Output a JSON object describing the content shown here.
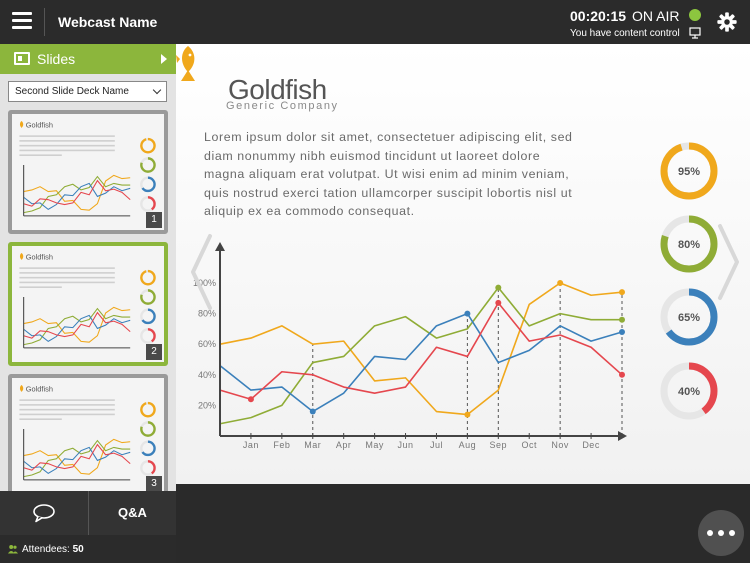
{
  "topbar": {
    "webcast_name": "Webcast Name",
    "timer": "00:20:15",
    "status": "ON AIR",
    "control_text": "You have content control",
    "status_color": "#8cc63f"
  },
  "sidebar": {
    "slides_label": "Slides",
    "deck_select": "Second Slide Deck Name",
    "thumbnails": [
      {
        "number": "1"
      },
      {
        "number": "2"
      },
      {
        "number": "3"
      }
    ],
    "qa_label": "Q&A",
    "attendees_label": "Attendees:",
    "attendees_count": "50",
    "accent_color": "#8cb63c"
  },
  "slide": {
    "brand_name": "Goldfish",
    "brand_sub": "Generic Company",
    "body_text": "Lorem ipsum dolor sit amet, consectetuer adipiscing elit, sed diam nonummy nibh euismod tincidunt ut laoreet dolore magna aliquam erat volutpat. Ut wisi enim ad minim veniam, quis nostrud exerci tation ullamcorper suscipit lobortis nisl ut aliquip ex ea commodo consequat.",
    "donuts": [
      {
        "label": "95%",
        "value": 95,
        "color": "#f0a81c"
      },
      {
        "label": "80%",
        "value": 80,
        "color": "#8fac36"
      },
      {
        "label": "65%",
        "value": 65,
        "color": "#3b80bb"
      },
      {
        "label": "40%",
        "value": 40,
        "color": "#e5474e"
      }
    ]
  },
  "chart_data": {
    "type": "line",
    "categories": [
      "Jan",
      "Feb",
      "Mar",
      "Apr",
      "May",
      "Jun",
      "Jul",
      "Aug",
      "Sep",
      "Oct",
      "Nov",
      "Dec"
    ],
    "y_ticks": [
      "20%",
      "40%",
      "60%",
      "80%",
      "100%"
    ],
    "ylim": [
      0,
      105
    ],
    "grid": false,
    "series": [
      {
        "color": "#f0a81c",
        "values": [
          60,
          64,
          72,
          60,
          62,
          36,
          38,
          16,
          14,
          30,
          86,
          100,
          92,
          94
        ]
      },
      {
        "color": "#8fac36",
        "values": [
          8,
          12,
          20,
          48,
          52,
          72,
          78,
          64,
          70,
          97,
          72,
          80,
          76,
          76
        ]
      },
      {
        "color": "#3b80bb",
        "values": [
          46,
          30,
          32,
          16,
          28,
          52,
          50,
          72,
          80,
          48,
          56,
          72,
          62,
          68
        ]
      },
      {
        "color": "#e5474e",
        "values": [
          30,
          24,
          42,
          40,
          32,
          28,
          32,
          58,
          52,
          87,
          62,
          66,
          58,
          40
        ]
      }
    ],
    "markers": [
      {
        "series": 0,
        "index": 8
      },
      {
        "series": 0,
        "index": 11
      },
      {
        "series": 0,
        "index": 13
      },
      {
        "series": 1,
        "index": 9
      },
      {
        "series": 1,
        "index": 13
      },
      {
        "series": 2,
        "index": 3
      },
      {
        "series": 2,
        "index": 8
      },
      {
        "series": 2,
        "index": 13
      },
      {
        "series": 3,
        "index": 1
      },
      {
        "series": 3,
        "index": 9
      },
      {
        "series": 3,
        "index": 13
      }
    ],
    "dashed_lines": [
      3,
      8,
      9,
      11,
      13
    ]
  }
}
